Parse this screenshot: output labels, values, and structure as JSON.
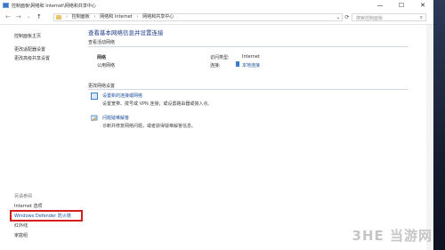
{
  "window": {
    "title": "控制面板\\网络和 Internet\\网络和共享中心",
    "controls": [
      "—",
      "☐",
      "✕"
    ]
  },
  "address_bar": {
    "nav": [
      "←",
      "→",
      "↑"
    ],
    "crumbs": [
      "控制面板",
      "网络和 Internet",
      "网络和共享中心"
    ],
    "dropdown": "⌄",
    "refresh": "⟳",
    "search_placeholder": "搜索控制面板"
  },
  "sidebar": {
    "links": [
      "控制面板主页",
      "更改适配器设置",
      "更改高级共享设置"
    ],
    "see_also_heading": "另请参阅",
    "see_also": [
      "Internet 选项",
      "Windows Defender 防火墙",
      "红外线",
      "家庭组"
    ]
  },
  "main": {
    "heading": "查看基本网络信息并设置连接",
    "active_networks_label": "查看活动网络",
    "network_name": "网络",
    "network_type": "公用网络",
    "access_type_label": "访问类型:",
    "access_type_value": "Internet",
    "connections_label": "连接:",
    "connections_value": "本地连接",
    "change_settings_label": "更改网络设置",
    "items": [
      {
        "title": "设置新的连接或网络",
        "desc": "设置宽带、拨号或 VPN 连接；或设置路由器或接入点。"
      },
      {
        "title": "问题疑难解答",
        "desc": "诊断并修复网络问题，或者获得疑难解答信息。"
      }
    ]
  },
  "watermark": "3HE 当游网"
}
